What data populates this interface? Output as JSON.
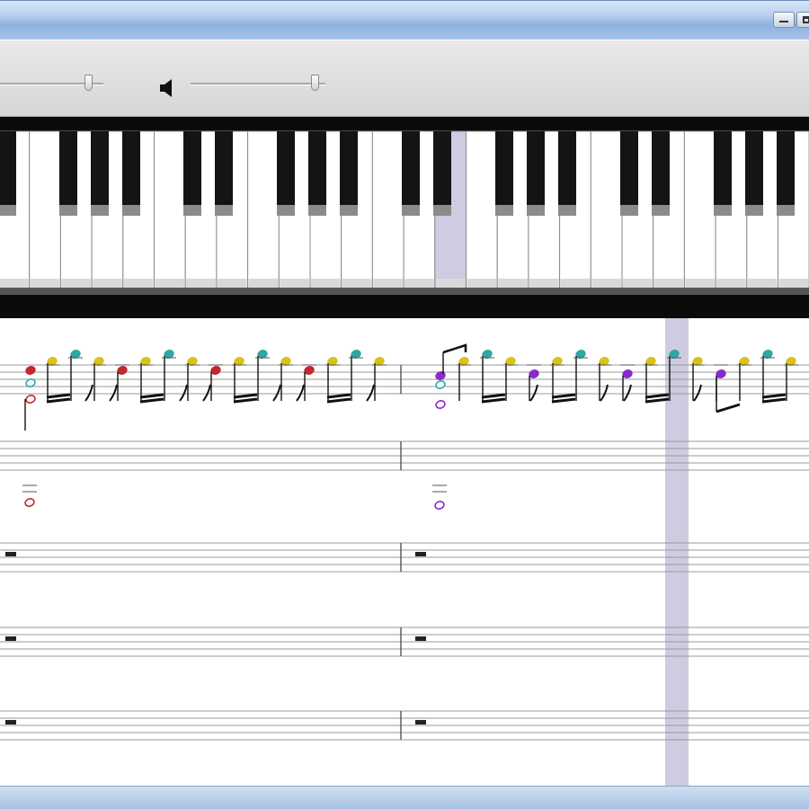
{
  "window": {
    "title": "",
    "controls": [
      {
        "name": "minimize-button",
        "icon": "minimize-icon"
      },
      {
        "name": "maximize-button",
        "icon": "maximize-icon"
      }
    ]
  },
  "toolbar": {
    "tempo_slider": {
      "value": 0.9,
      "icon": "none"
    },
    "volume_slider": {
      "value": 0.95,
      "icon": "speaker-icon"
    }
  },
  "piano": {
    "highlighted_key_color": "#cfcbe0",
    "white_key_color": "#ffffff",
    "black_key_color": "#141414"
  },
  "score": {
    "note_colors": {
      "red": "#c0292f",
      "yellow": "#d9c21a",
      "cyan": "#2fa7a3",
      "purple": "#8a2bc8"
    },
    "playhead_color": "#cfcbe0",
    "staves": [
      {
        "name": "melody-staff",
        "rests": []
      },
      {
        "name": "bass-staff",
        "rests": []
      },
      {
        "name": "track-3-staff",
        "rests": [
          "whole-rest",
          "whole-rest"
        ]
      },
      {
        "name": "track-4-staff",
        "rests": [
          "whole-rest",
          "whole-rest"
        ]
      },
      {
        "name": "track-5-staff",
        "rests": [
          "whole-rest",
          "whole-rest"
        ]
      }
    ]
  }
}
